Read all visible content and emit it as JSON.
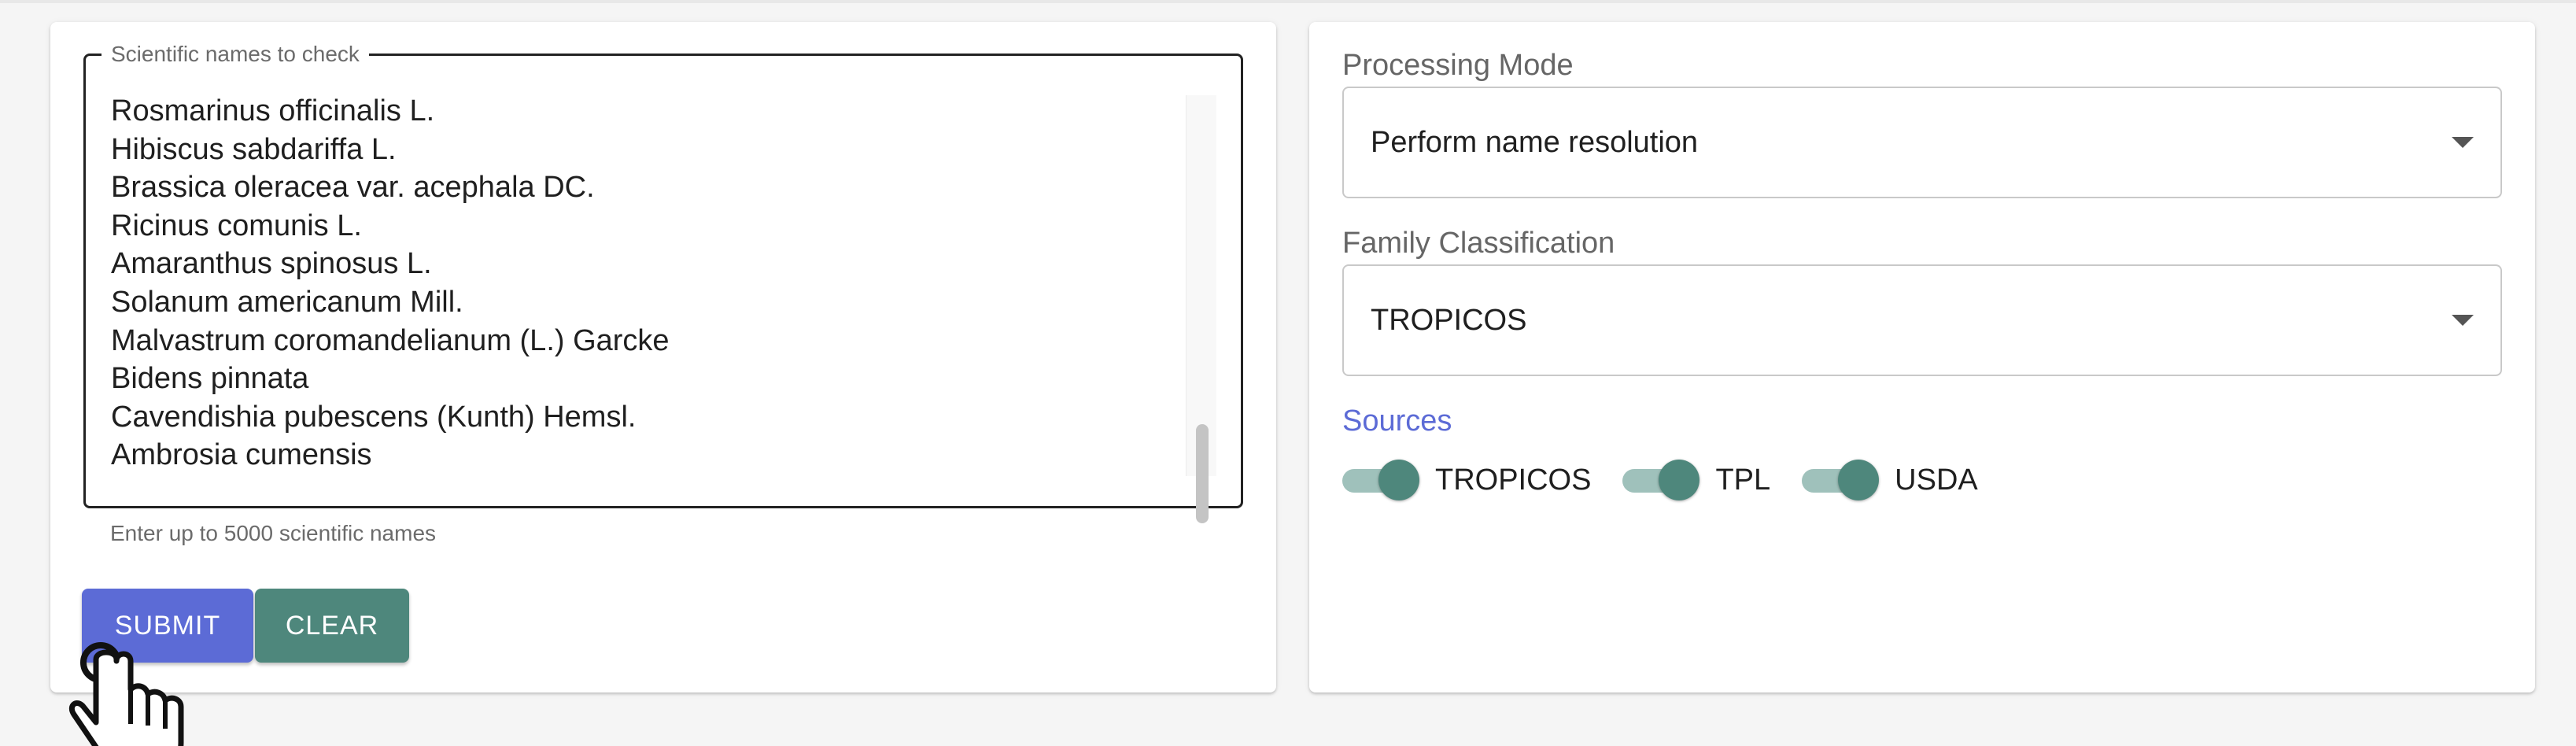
{
  "left_panel": {
    "textarea_legend": "Scientific names to check",
    "names": [
      "Rosmarinus officinalis L.",
      "Hibiscus sabdariffa L.",
      "Brassica oleracea var. acephala DC.",
      "Ricinus comunis L.",
      "Amaranthus spinosus L.",
      "Solanum americanum Mill.",
      "Malvastrum coromandelianum (L.) Garcke",
      "Bidens pinnata",
      "Cavendishia pubescens (Kunth) Hemsl.",
      "Ambrosia cumensis"
    ],
    "helper_text": "Enter up to 5000 scientific names",
    "submit_label": "SUBMIT",
    "clear_label": "CLEAR"
  },
  "right_panel": {
    "processing_mode_label": "Processing Mode",
    "processing_mode_value": "Perform name resolution",
    "family_classification_label": "Family Classification",
    "family_classification_value": "TROPICOS",
    "sources_label": "Sources",
    "sources": [
      {
        "label": "TROPICOS",
        "enabled": true
      },
      {
        "label": "TPL",
        "enabled": true
      },
      {
        "label": "USDA",
        "enabled": true
      }
    ]
  },
  "colors": {
    "submit": "#5c6bd6",
    "clear": "#4e877c",
    "toggle_on": "#4e877c",
    "sources_label": "#5c6bd6"
  },
  "icons": {
    "cursor": "pointer-hand-icon",
    "select_caret": "chevron-down-icon"
  }
}
